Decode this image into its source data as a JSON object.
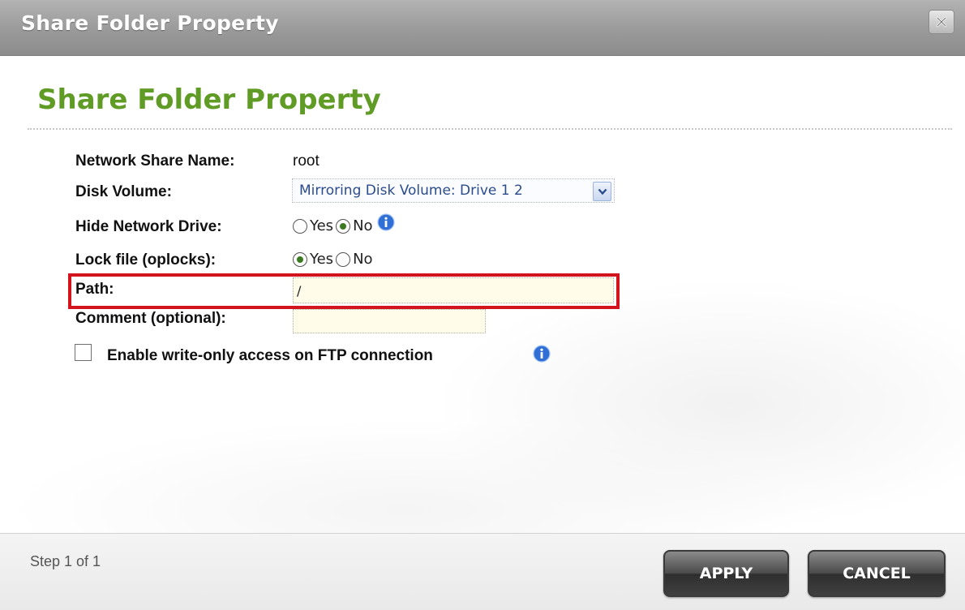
{
  "window": {
    "title": "Share Folder Property",
    "close_icon": "close-icon"
  },
  "form": {
    "heading": "Share Folder Property",
    "share_name": {
      "label": "Network Share Name:",
      "value": "root"
    },
    "disk_volume": {
      "label": "Disk Volume:",
      "selected": "Mirroring Disk Volume: Drive 1 2"
    },
    "hide_drive": {
      "label": "Hide Network Drive:",
      "options": [
        "Yes",
        "No"
      ],
      "selected": "No"
    },
    "lock_file": {
      "label": "Lock file (oplocks):",
      "options": [
        "Yes",
        "No"
      ],
      "selected": "Yes"
    },
    "path": {
      "label": "Path:",
      "value": "/"
    },
    "comment": {
      "label": "Comment (optional):",
      "value": ""
    },
    "ftp_write_only": {
      "label": "Enable write-only access on FTP connection",
      "checked": false
    }
  },
  "footer": {
    "step": "Step 1 of 1",
    "apply_label": "APPLY",
    "cancel_label": "CANCEL"
  },
  "colors": {
    "heading_green": "#5f9b25",
    "highlight_red": "#d4141c",
    "info_blue": "#2f6fd6"
  }
}
